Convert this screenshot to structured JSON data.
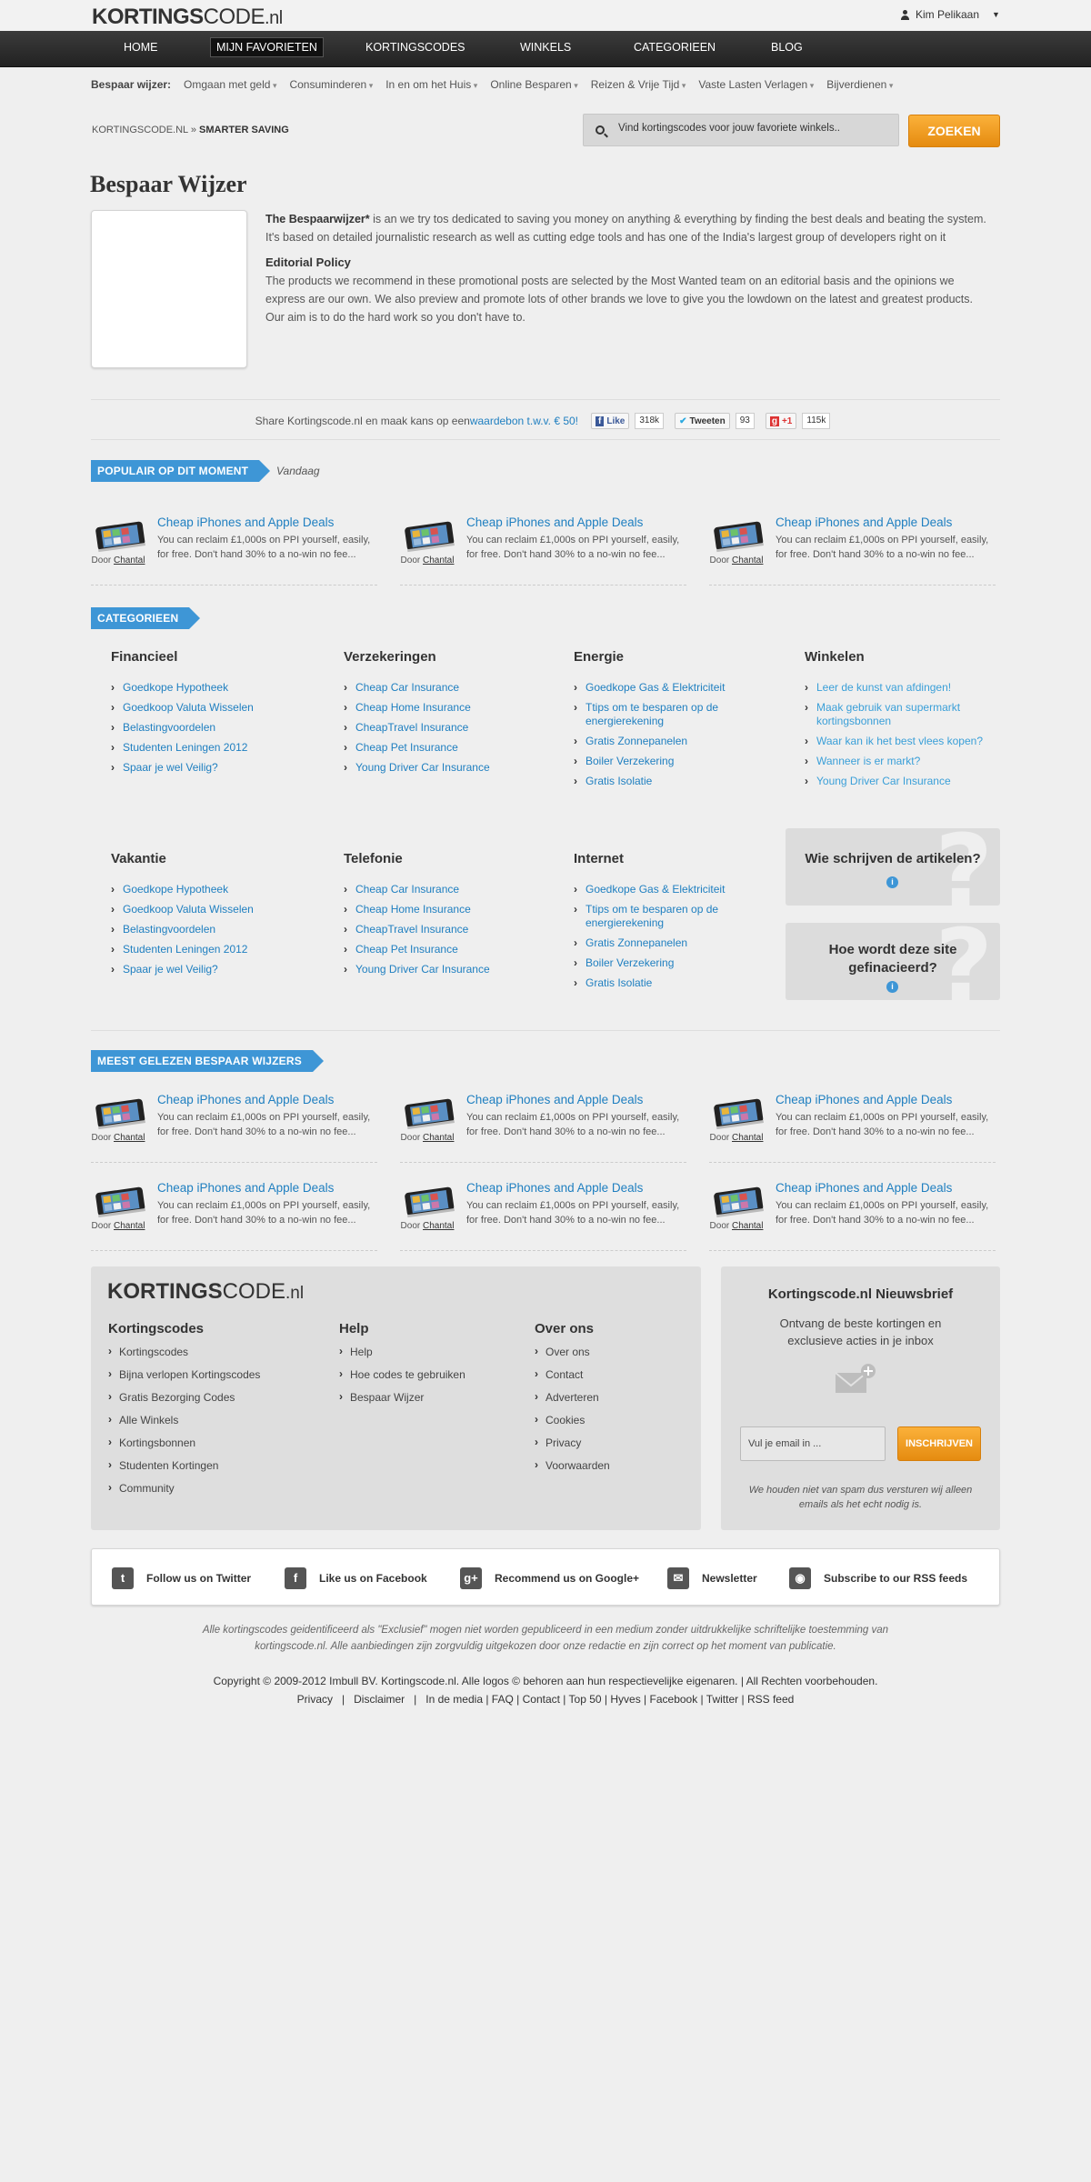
{
  "header": {
    "logo_bold": "KORTINGS",
    "logo_rest": "CODE",
    "logo_tld": ".nl",
    "user_name": "Kim Pelikaan"
  },
  "nav": [
    "HOME",
    "MIJN FAVORIETEN",
    "KORTINGSCODES",
    "WINKELS",
    "CATEGORIEEN",
    "BLOG"
  ],
  "subnav": {
    "label": "Bespaar wijzer:",
    "items": [
      "Omgaan met geld",
      "Consuminderen",
      "In en om het Huis",
      "Online Besparen",
      "Reizen & Vrije Tijd",
      "Vaste Lasten Verlagen",
      "Bijverdienen"
    ]
  },
  "breadcrumb": {
    "home": "KORTINGSCODE.NL",
    "sep": "»",
    "current": "SMARTER SAVING"
  },
  "search": {
    "placeholder": "Vind kortingscodes voor jouw favoriete winkels..",
    "button": "ZOEKEN"
  },
  "page": {
    "title": "Bespaar Wijzer",
    "intro_bold": "The Bespaarwijzer*",
    "intro_text": " is an we try tos dedicated to saving you money on anything & everything by finding the best deals and beating the system. It's based on detailed journalistic research as well as cutting edge tools and has one of the India's largest group of developers right on it",
    "policy_title": "Editorial Policy",
    "policy_text": "The products we recommend in these promotional posts are selected by the Most Wanted team on an editorial basis and the opinions we express are our own. We also preview and promote lots of other brands we love to give you the lowdown on the latest and greatest products. Our aim is to do the hard work so you don't have to."
  },
  "share": {
    "text": "Share Kortingscode.nl en maak kans op een ",
    "link": "waardebon t.w.v. € 50!",
    "fb_label": "Like",
    "fb_count": "318k",
    "tw_label": "Tweeten",
    "tw_count": "93",
    "gp_label": "+1",
    "gp_count": "115k"
  },
  "popular": {
    "ribbon": "POPULAIR OP DIT MOMENT",
    "sub": "Vandaag",
    "deals": [
      {
        "title": "Cheap iPhones and Apple Deals",
        "desc": "You can reclaim £1,000s on PPI yourself, easily, for free. Don't hand 30% to a no-win no fee...",
        "door": "Door",
        "author": "Chantal"
      },
      {
        "title": "Cheap iPhones and Apple Deals",
        "desc": "You can reclaim £1,000s on PPI yourself, easily, for free. Don't hand 30% to a no-win no fee...",
        "door": "Door",
        "author": "Chantal"
      },
      {
        "title": "Cheap iPhones and Apple Deals",
        "desc": "You can reclaim £1,000s on PPI yourself, easily, for free. Don't hand 30% to a no-win no fee...",
        "door": "Door",
        "author": "Chantal"
      }
    ]
  },
  "categories": {
    "ribbon": "CATEGORIEEN",
    "groups": [
      {
        "title": "Financieel",
        "items": [
          "Goedkope Hypotheek",
          "Goedkoop Valuta Wisselen",
          "Belastingvoordelen",
          "Studenten Leningen 2012",
          "Spaar je wel Veilig?"
        ]
      },
      {
        "title": "Verzekeringen",
        "items": [
          "Cheap Car Insurance",
          "Cheap Home Insurance",
          "CheapTravel Insurance",
          "Cheap Pet Insurance",
          "Young Driver Car Insurance"
        ]
      },
      {
        "title": "Energie",
        "items": [
          "Goedkope Gas & Elektriciteit",
          "Ttips om te besparen op de energierekening",
          "Gratis Zonnepanelen",
          "Boiler Verzekering",
          "Gratis Isolatie"
        ]
      },
      {
        "title": "Winkelen",
        "items": [
          "Leer de kunst van afdingen!",
          "Maak gebruik van supermarkt kortingsbonnen",
          "Waar kan ik het best vlees kopen?",
          "Wanneer is er markt?",
          "Young Driver Car Insurance"
        ]
      },
      {
        "title": "Vakantie",
        "items": [
          "Goedkope Hypotheek",
          "Goedkoop Valuta Wisselen",
          "Belastingvoordelen",
          "Studenten Leningen 2012",
          "Spaar je wel Veilig?"
        ]
      },
      {
        "title": "Telefonie",
        "items": [
          "Cheap Car Insurance",
          "Cheap Home Insurance",
          "CheapTravel Insurance",
          "Cheap Pet Insurance",
          "Young Driver Car Insurance"
        ]
      },
      {
        "title": "Internet",
        "items": [
          "Goedkope Gas & Elektriciteit",
          "Ttips om te besparen op de energierekening",
          "Gratis Zonnepanelen",
          "Boiler Verzekering",
          "Gratis Isolatie"
        ]
      }
    ],
    "q1": "Wie schrijven de artikelen?",
    "q2": "Hoe wordt deze site gefinacieerd?",
    "info_icon": "i"
  },
  "most_read": {
    "ribbon": "MEEST GELEZEN BESPAAR WIJZERS",
    "deals": [
      {
        "title": "Cheap iPhones and Apple Deals",
        "desc": "You can reclaim £1,000s on PPI yourself, easily, for free. Don't hand 30% to a no-win no fee...",
        "door": "Door",
        "author": "Chantal"
      },
      {
        "title": "Cheap iPhones and Apple Deals",
        "desc": "You can reclaim £1,000s on PPI yourself, easily, for free. Don't hand 30% to a no-win no fee...",
        "door": "Door",
        "author": "Chantal"
      },
      {
        "title": "Cheap iPhones and Apple Deals",
        "desc": "You can reclaim £1,000s on PPI yourself, easily, for free. Don't hand 30% to a no-win no fee...",
        "door": "Door",
        "author": "Chantal"
      },
      {
        "title": "Cheap iPhones and Apple Deals",
        "desc": "You can reclaim £1,000s on PPI yourself, easily, for free. Don't hand 30% to a no-win no fee...",
        "door": "Door",
        "author": "Chantal"
      },
      {
        "title": "Cheap iPhones and Apple Deals",
        "desc": "You can reclaim £1,000s on PPI yourself, easily, for free. Don't hand 30% to a no-win no fee...",
        "door": "Door",
        "author": "Chantal"
      },
      {
        "title": "Cheap iPhones and Apple Deals",
        "desc": "You can reclaim £1,000s on PPI yourself, easily, for free. Don't hand 30% to a no-win no fee...",
        "door": "Door",
        "author": "Chantal"
      }
    ]
  },
  "footer": {
    "cols": [
      {
        "title": "Kortingscodes",
        "items": [
          "Kortingscodes",
          "Bijna verlopen Kortingscodes",
          "Gratis Bezorging Codes",
          "Alle Winkels",
          "Kortingsbonnen",
          "Studenten Kortingen",
          "Community"
        ]
      },
      {
        "title": "Help",
        "items": [
          "Help",
          "Hoe codes te gebruiken",
          "Bespaar Wijzer"
        ]
      },
      {
        "title": "Over ons",
        "items": [
          "Over ons",
          "Contact",
          "Adverteren",
          "Cookies",
          "Privacy",
          "Voorwaarden"
        ]
      }
    ],
    "newsletter": {
      "title": "Kortingscode.nl Nieuwsbrief",
      "subtitle": "Ontvang de beste kortingen en exclusieve acties in je inbox",
      "placeholder": "Vul je email in ...",
      "button": "INSCHRIJVEN",
      "note": "We houden niet van spam dus versturen wij alleen emails als het echt nodig is."
    },
    "social": [
      {
        "icon": "twitter-icon",
        "glyph": "t",
        "label": "Follow us on Twitter"
      },
      {
        "icon": "facebook-icon",
        "glyph": "f",
        "label": "Like us on Facebook"
      },
      {
        "icon": "google-plus-icon",
        "glyph": "g+",
        "label": "Recommend us on Google+"
      },
      {
        "icon": "newsletter-icon",
        "glyph": "✉",
        "label": "Newsletter"
      },
      {
        "icon": "rss-icon",
        "glyph": "◉",
        "label": "Subscribe to our RSS feeds"
      }
    ],
    "disclaimer": "Alle kortingscodes geidentificeerd als \"Exclusief\" mogen niet worden gepubliceerd in een medium zonder uitdrukkelijke schriftelijke toestemming van kortingscode.nl. Alle aanbiedingen zijn zorgvuldig uitgekozen door onze redactie en zijn correct op het moment van publicatie.",
    "copyright": "Copyright © 2009-2012 Imbull BV. Kortingscode.nl. Alle logos © behoren aan hun respectievelijke eigenaren. | All Rechten voorbehouden.",
    "links": [
      "Privacy",
      "Disclaimer",
      "In de media",
      "FAQ",
      "Contact",
      "Top 50",
      "Hyves",
      "Facebook",
      "Twitter",
      "RSS feed"
    ]
  },
  "colors": {
    "accent": "#3e96d6",
    "orange": "#f0a02a",
    "link": "#1f7fc0"
  }
}
